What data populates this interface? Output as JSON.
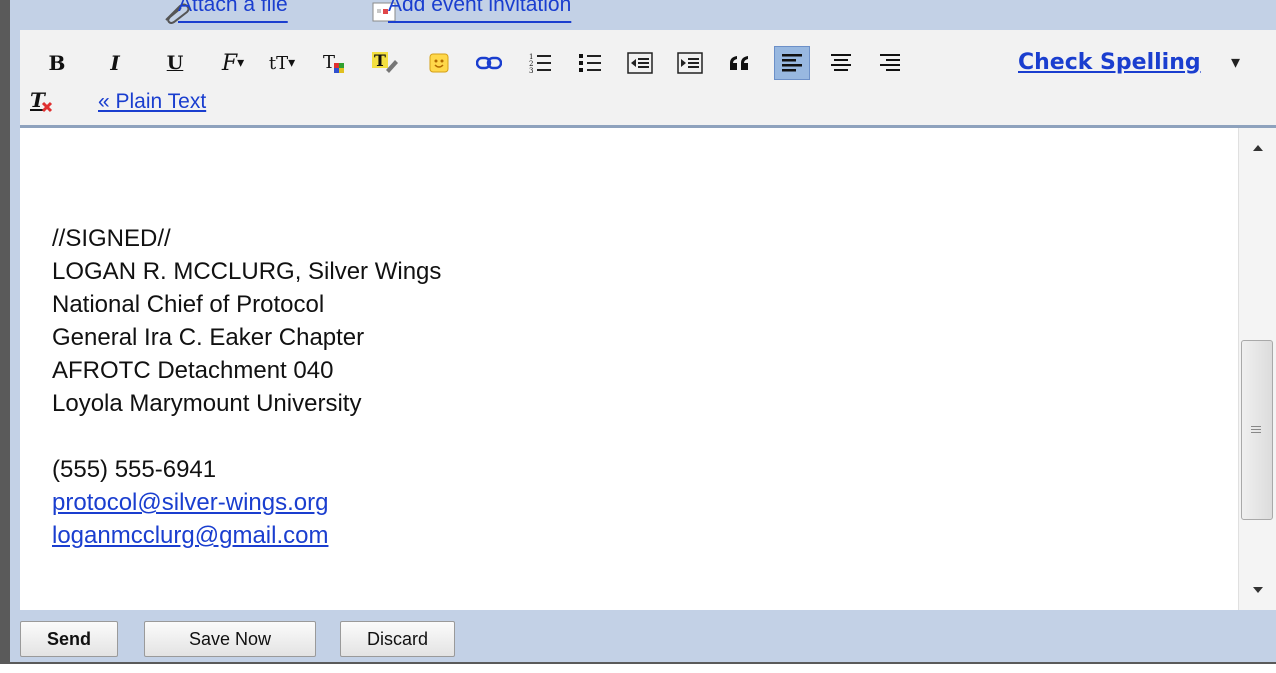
{
  "attach": {
    "attach_file_label": "Attach a file",
    "add_event_label": "Add event invitation"
  },
  "toolbar": {
    "bold_label": "B",
    "italic_label": "I",
    "underline_label": "U",
    "font_label": "F",
    "size_label": "tT",
    "check_spelling_label": "Check Spelling",
    "check_spelling_caret": "▾",
    "plain_text_label": "« Plain Text"
  },
  "editor": {
    "lines": [
      "//SIGNED//",
      "LOGAN R. MCCLURG, Silver Wings",
      "National Chief of Protocol",
      "General Ira C. Eaker Chapter",
      "AFROTC Detachment 040",
      "Loyola Marymount University",
      "",
      "(555) 555-6941"
    ],
    "links": [
      "protocol@silver-wings.org",
      "loganmcclurg@gmail.com"
    ]
  },
  "actions": {
    "send_label": "Send",
    "save_label": "Save Now",
    "discard_label": "Discard"
  },
  "colors": {
    "link": "#1a3ecf",
    "chrome": "#c3d1e6",
    "toolbar_bg": "#f2f2f2",
    "active_button": "#98b8e0"
  }
}
